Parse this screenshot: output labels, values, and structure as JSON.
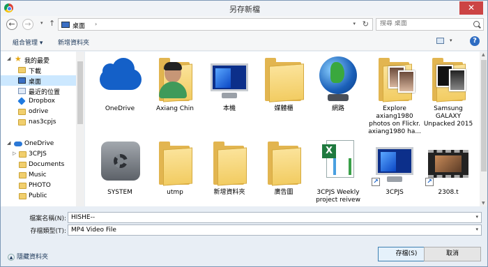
{
  "window": {
    "title": "另存新檔",
    "close_glyph": "✕"
  },
  "address": {
    "back_glyph": "←",
    "forward_glyph": "→",
    "up_glyph": "↑",
    "dropdown_glyph": "▾",
    "path": "桌面",
    "separator": "›",
    "refresh_glyph": "↻",
    "search_placeholder": "搜尋 桌面"
  },
  "toolbar": {
    "organize_label": "組合管理 ▾",
    "new_folder_label": "新增資料夾",
    "help_glyph": "?"
  },
  "nav": {
    "items": [
      {
        "label": "我的最愛",
        "icon": "star-icon",
        "expand": "◢"
      },
      {
        "label": "下載",
        "icon": "folder-icon"
      },
      {
        "label": "桌面",
        "icon": "desktop-icon"
      },
      {
        "label": "最近的位置",
        "icon": "recent-icon"
      },
      {
        "label": "Dropbox",
        "icon": "dropbox-icon"
      },
      {
        "label": "odrive",
        "icon": "folder-icon"
      },
      {
        "label": "nas3cpjs",
        "icon": "folder-icon"
      },
      {
        "label": "OneDrive",
        "icon": "onedrive-icon",
        "expand": "◢"
      },
      {
        "label": "3CPJS",
        "icon": "folder-icon",
        "expand": "▷"
      },
      {
        "label": "Documents",
        "icon": "folder-icon"
      },
      {
        "label": "Music",
        "icon": "folder-icon"
      },
      {
        "label": "PHOTO",
        "icon": "folder-icon"
      },
      {
        "label": "Public",
        "icon": "folder-icon"
      }
    ]
  },
  "files": [
    {
      "label": "OneDrive",
      "icon": "onedrive-icon"
    },
    {
      "label": "Axiang Chin",
      "icon": "user-folder-icon"
    },
    {
      "label": "本機",
      "icon": "computer-icon"
    },
    {
      "label": "媒體櫃",
      "icon": "library-icon"
    },
    {
      "label": "網路",
      "icon": "network-icon"
    },
    {
      "label": "Explore axiang1980 photos on Flickr. axiang1980 ha...",
      "icon": "photo-folder-icon"
    },
    {
      "label": "Samsung GALAXY Unpacked 2015",
      "icon": "photo-folder-icon"
    },
    {
      "label": "SYSTEM",
      "icon": "system-icon"
    },
    {
      "label": "utmp",
      "icon": "folder-icon"
    },
    {
      "label": "新增資料夾",
      "icon": "folder-icon"
    },
    {
      "label": "廣告圖",
      "icon": "folder-icon"
    },
    {
      "label": "3CPJS Weekly project reivew",
      "icon": "excel-icon"
    },
    {
      "label": "3CPJS",
      "icon": "computer-shortcut-icon"
    },
    {
      "label": "2308.t",
      "icon": "video-icon"
    }
  ],
  "form": {
    "filename_label": "檔案名稱(N):",
    "filename_value": "HISHE--",
    "filetype_label": "存檔類型(T):",
    "filetype_value": "MP4 Video File"
  },
  "footer": {
    "hide_folders_label": "隱藏資料夾",
    "save_label": "存檔(S)",
    "cancel_label": "取消"
  }
}
